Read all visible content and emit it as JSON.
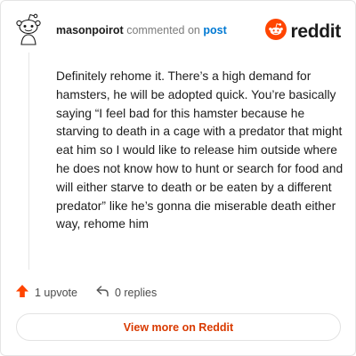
{
  "comment": {
    "username": "masonpoirot",
    "commented_on": "commented on",
    "post_link": "post",
    "body": "Definitely rehome it. There’s a high demand for hamsters, he will be adopted quick. You’re basically saying “I feel bad for this hamster because he starving to death in a cage with a predator that might eat him so I would like to release him outside where he does not know how to hunt or search for food and will either starve to death or be eaten by a different predator” like he’s gonna die miserable death either way, rehome him"
  },
  "brand": {
    "wordmark": "reddit",
    "logo_icon": "reddit-logo-icon",
    "color": "#ff4500"
  },
  "avatar": {
    "icon": "snoo-avatar-icon"
  },
  "actions": {
    "upvote_icon": "upvote-arrow-icon",
    "upvote_label": "1 upvote",
    "upvote_color": "#ff4500",
    "reply_icon": "reply-arrow-icon",
    "replies_label": "0 replies"
  },
  "cta": {
    "label": "View more on Reddit",
    "color": "#d93a00"
  }
}
